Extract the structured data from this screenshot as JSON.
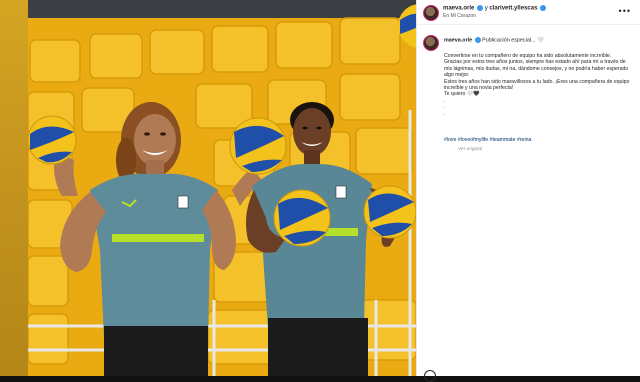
{
  "header": {
    "username": "maeva.orle",
    "connector": "y",
    "collaborator": "clarivett.yllescas",
    "subtitle": "En Mi Corazon",
    "more_icon": "more-horizontal-icon"
  },
  "post": {
    "author": "maeva.orle",
    "title": "Publicación especial... 🤍",
    "lines": [
      "Convertirse en tu compañero de equipo ha sido absolutamente increíble.",
      "Gracias por estos tres años juntos, siempre has estado ahí para mí a través de mis lágrimas, mis dudas, mi ira, dándome consejos, y no podría haber esperado algo mejor.",
      "Estos tres años han sido maravillosos a tu lado. ¡Eres una compañera de equipo increíble y una novia perfecta!",
      "Te quiero 🤍🖤",
      ".",
      ".",
      "."
    ],
    "hashtags": "#love #loveofmylife #teammate #reina",
    "translate": "Ver original"
  },
  "colors": {
    "seat_yellow": "#f2b51d",
    "shirt_gray": "#5b8897",
    "accent_green": "#b7e02a",
    "ball_yellow": "#f3c21b",
    "ball_blue": "#1f4fa8"
  }
}
